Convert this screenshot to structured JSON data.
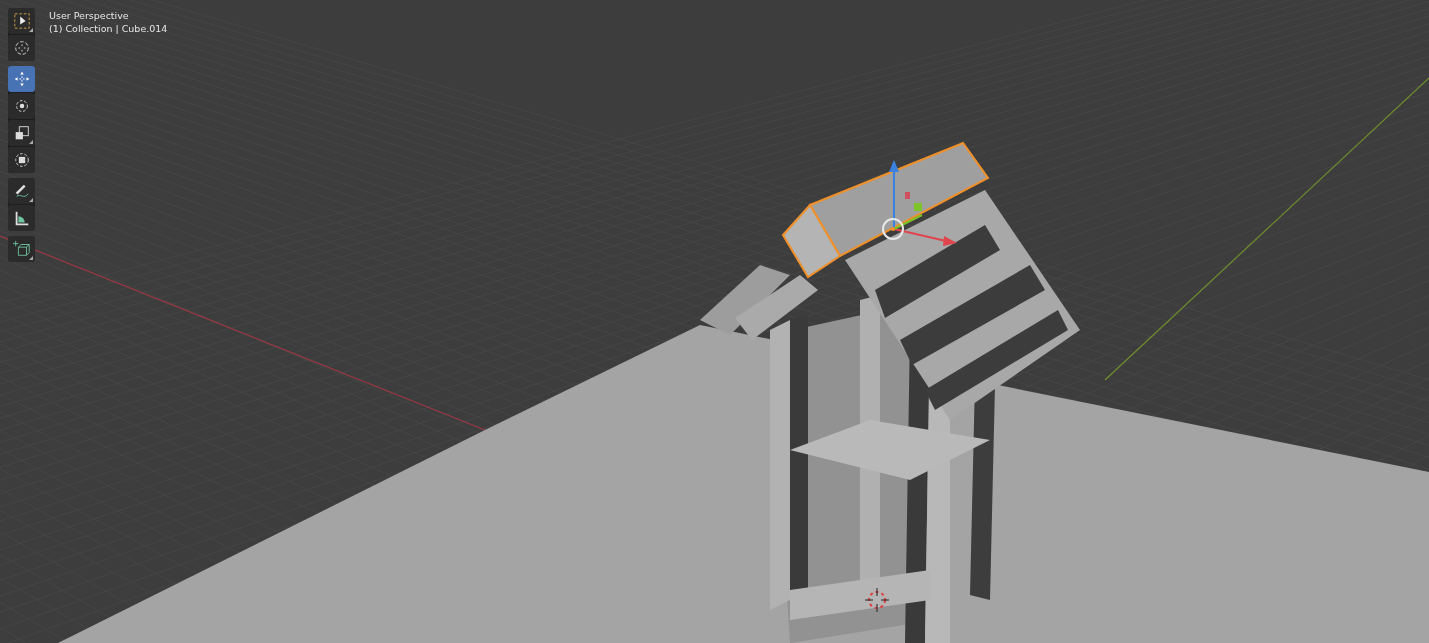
{
  "viewport": {
    "view_name": "User Perspective",
    "object_info": "(1) Collection | Cube.014"
  },
  "toolbar": {
    "groups": [
      [
        {
          "kind": "select",
          "selected": false,
          "has_submenu": true
        },
        {
          "kind": "cursor",
          "selected": false,
          "has_submenu": false
        }
      ],
      [
        {
          "kind": "move",
          "selected": true,
          "has_submenu": false
        },
        {
          "kind": "rotate",
          "selected": false,
          "has_submenu": false
        },
        {
          "kind": "scale",
          "selected": false,
          "has_submenu": true
        },
        {
          "kind": "transform",
          "selected": false,
          "has_submenu": false
        }
      ],
      [
        {
          "kind": "annotate",
          "selected": false,
          "has_submenu": true
        },
        {
          "kind": "measure",
          "selected": false,
          "has_submenu": false
        }
      ],
      [
        {
          "kind": "add-cube",
          "selected": false,
          "has_submenu": true
        }
      ]
    ]
  }
}
